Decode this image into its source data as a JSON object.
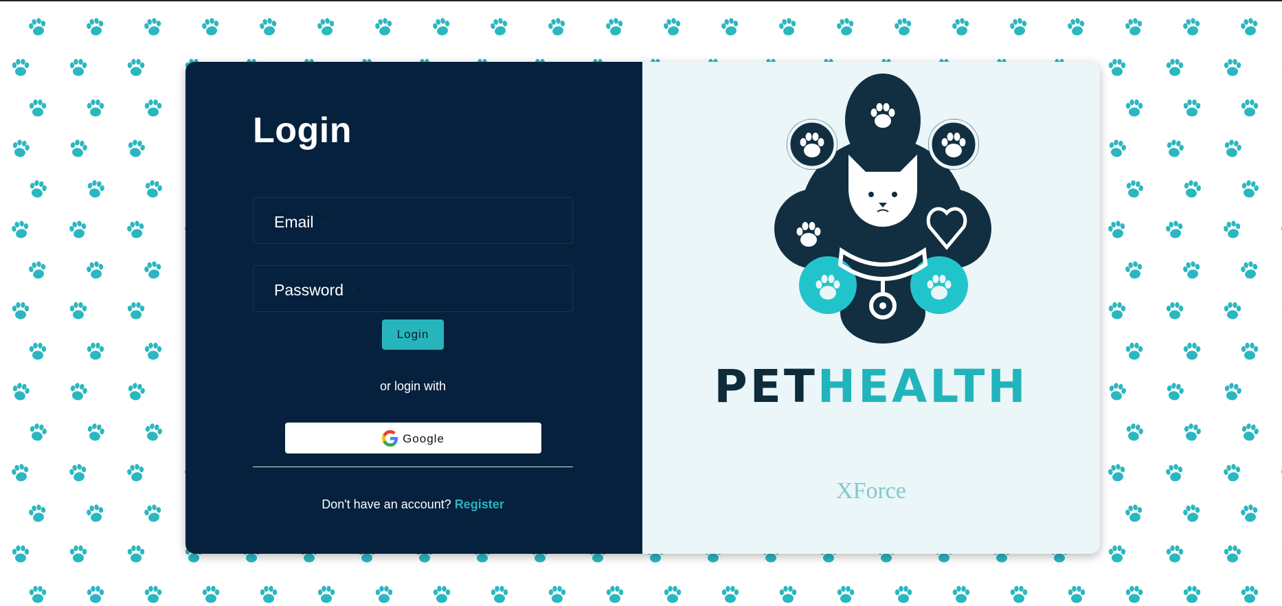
{
  "login": {
    "title": "Login",
    "email_label": "Email",
    "password_label": "Password",
    "required_marker": "*",
    "login_button": "Login",
    "or_text": "or login with",
    "google_button": "Google",
    "no_account_text": "Don't have an account?",
    "register_link": "Register"
  },
  "brand": {
    "name_part1": "PET",
    "name_part2": "HEALTH",
    "subtitle": "XForce"
  },
  "colors": {
    "background": "#ffffff",
    "paw": "#2bb7c0",
    "panel_dark": "#05213d",
    "accent": "#27b5bd",
    "logo_dark": "#112f40",
    "right_panel": "#eaf6f8"
  },
  "icons": {
    "background_pattern": "paw-print-icon",
    "google": "google-g-icon",
    "logo": "pet-logo"
  }
}
